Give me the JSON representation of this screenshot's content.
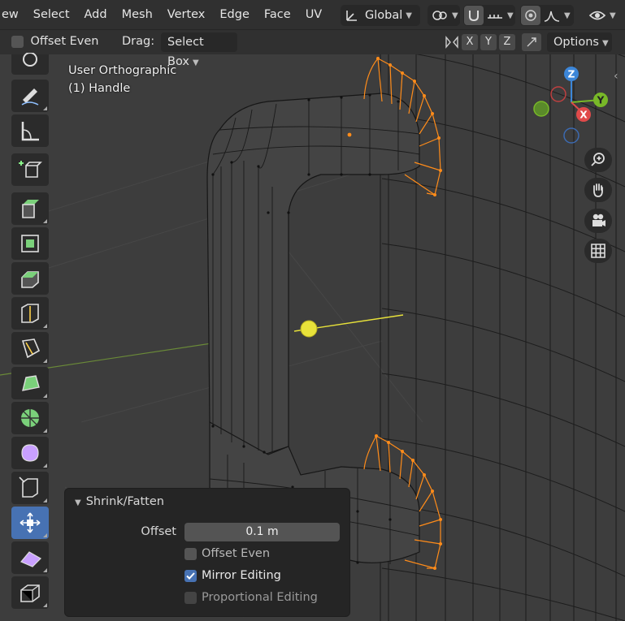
{
  "menu": {
    "items": [
      "ew",
      "Select",
      "Add",
      "Mesh",
      "Vertex",
      "Edge",
      "Face",
      "UV"
    ]
  },
  "header": {
    "orientation": "Global"
  },
  "operator_bar": {
    "offset_even": "Offset Even",
    "drag_label": "Drag:",
    "drag_value": "Select Box",
    "axes": [
      "X",
      "Y",
      "Z"
    ],
    "options": "Options"
  },
  "viewport": {
    "view_name": "User Orthographic",
    "object_name": "(1) Handle"
  },
  "gizmo": {
    "z": "Z",
    "y": "Y",
    "x": "X"
  },
  "toolbar": {
    "active_tool": "shrink-fatten"
  },
  "last_op_panel": {
    "title": "Shrink/Fatten",
    "offset_label": "Offset",
    "offset_value": "0.1 m",
    "offset_even": {
      "label": "Offset Even",
      "checked": false
    },
    "mirror_editing": {
      "label": "Mirror Editing",
      "checked": true
    },
    "proportional_editing": {
      "label": "Proportional Editing",
      "checked": false
    }
  },
  "colors": {
    "accent": "#4772b3",
    "selection": "#ff8c1a",
    "axis_x": "#e04a4a",
    "axis_y": "#78b828",
    "axis_z": "#3c86d8"
  }
}
